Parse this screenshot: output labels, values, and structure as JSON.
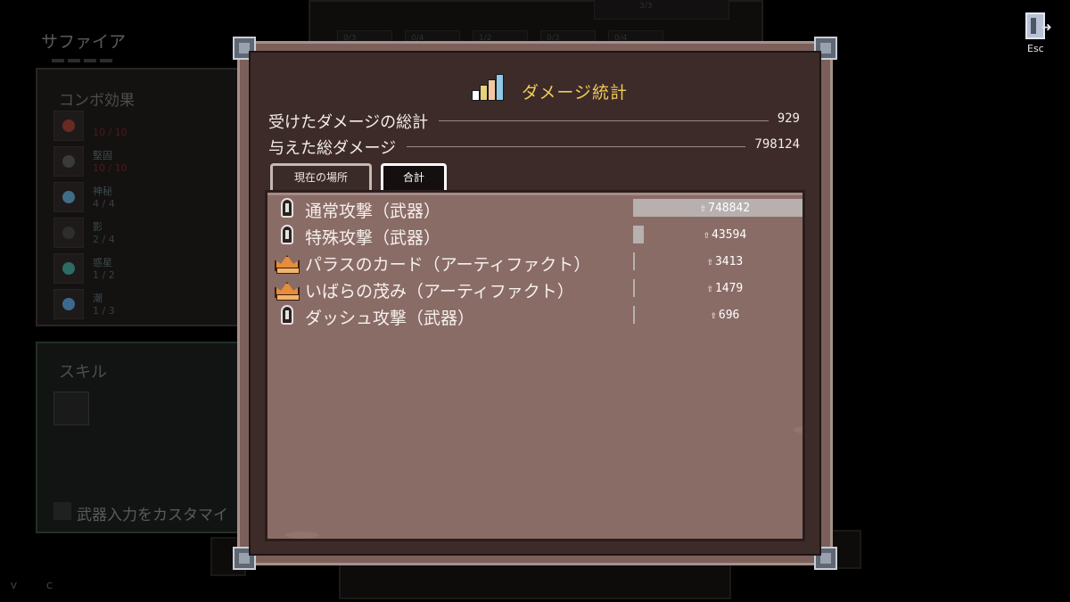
{
  "background": {
    "character_name": "サファイア",
    "combo_panel": {
      "title": "コンボ効果",
      "items": [
        {
          "name": "",
          "count": "10 / 10",
          "icon": "red-crest-icon",
          "color": "#6a2a24",
          "red": true
        },
        {
          "name": "堅固",
          "count": "10 / 10",
          "icon": "shield-icon",
          "color": "#3a3a3a",
          "red": true
        },
        {
          "name": "神秘",
          "count": "4 / 4",
          "icon": "star-icon",
          "color": "#3f6d86",
          "red": false
        },
        {
          "name": "影",
          "count": "2 / 4",
          "icon": "shadow-icon",
          "color": "#2d2d2d",
          "red": false
        },
        {
          "name": "惑星",
          "count": "1 / 2",
          "icon": "planet-icon",
          "color": "#2f6b64",
          "red": false
        },
        {
          "name": "潮",
          "count": "1 / 3",
          "icon": "drop-icon",
          "color": "#3c6a8e",
          "red": false
        }
      ]
    },
    "skill_panel": {
      "title": "スキル",
      "customize_label": "武器入力をカスタマイ"
    },
    "top_cells": [
      "0/3",
      "0/4",
      "1/2",
      "0/3",
      "0/4"
    ],
    "top_counter": "3/3",
    "footer_keys": [
      "V",
      "C"
    ],
    "esc_label": "Esc"
  },
  "dialog": {
    "title": "ダメージ統計",
    "title_icon": "bar-chart-icon",
    "stats": [
      {
        "label": "受けたダメージの総計",
        "value": "929"
      },
      {
        "label": "与えた総ダメージ",
        "value": "798124"
      }
    ],
    "tabs": [
      {
        "label": "現在の場所",
        "active": false
      },
      {
        "label": "合計",
        "active": true
      }
    ],
    "damage_glyph": "⇧",
    "rows": [
      {
        "name": "通常攻撃（武器）",
        "value": "748842",
        "amount": 748842,
        "icon": "sword-icon",
        "kind": "weapon"
      },
      {
        "name": "特殊攻撃（武器）",
        "value": "43594",
        "amount": 43594,
        "icon": "sword-icon",
        "kind": "weapon"
      },
      {
        "name": "パラスのカード（アーティファクト）",
        "value": "3413",
        "amount": 3413,
        "icon": "crown-icon",
        "kind": "artifact"
      },
      {
        "name": "いばらの茂み（アーティファクト）",
        "value": "1479",
        "amount": 1479,
        "icon": "crown-icon",
        "kind": "artifact"
      },
      {
        "name": "ダッシュ攻撃（武器）",
        "value": "696",
        "amount": 696,
        "icon": "sword-icon",
        "kind": "weapon"
      }
    ],
    "colors": {
      "title": "#f1c95a",
      "bar": "#b7b0ae",
      "frame": "#7b5f5a",
      "panel": "#8a6c67"
    }
  }
}
